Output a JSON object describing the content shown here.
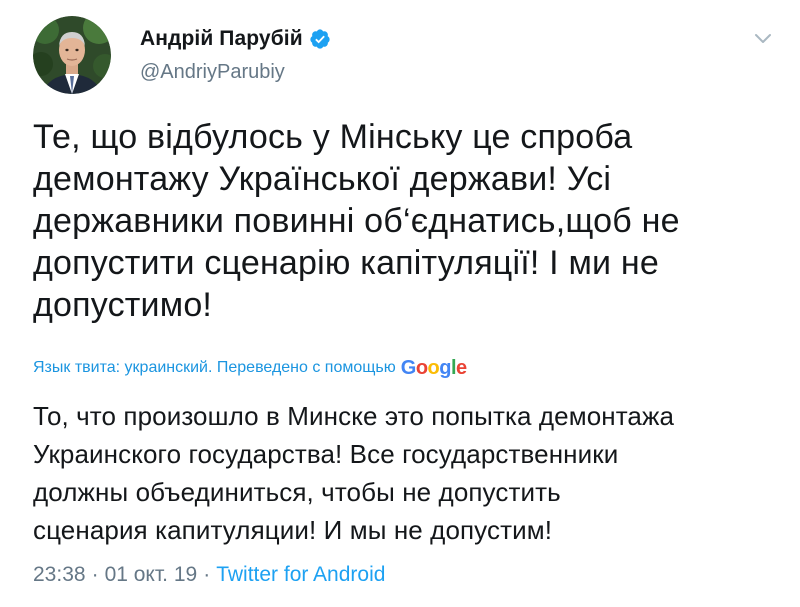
{
  "author": {
    "display_name": "Андрій Парубій",
    "handle": "@AndriyParubiy",
    "verified_icon": "verified-badge-icon",
    "avatar_icon": "avatar-photo"
  },
  "menu_icon": "chevron-down-icon",
  "tweet": {
    "text": "Те, що відбулось у Мінську це  спроба\nдемонтажу Української держави! Усі\nдержавники повинні об‘єднатись,щоб не\nдопустити сценарію капітуляції! І ми не\nдопустимо!"
  },
  "translation": {
    "label": "Язык твита: украинский. Переведено с помощью",
    "provider": "Google",
    "text": "То, что произошло в Минске это попытка демонтажа\nУкраинского государства! Все государственники\nдолжны объединиться, чтобы не допустить\nсценария капитуляции! И мы не допустим!"
  },
  "meta": {
    "time": "23:38",
    "date": "01 окт. 19",
    "separator": "·",
    "source": "Twitter for Android"
  },
  "colors": {
    "link": "#1da1f2",
    "text": "#14171a",
    "secondary": "#657786",
    "verified": "#1da1f2"
  }
}
